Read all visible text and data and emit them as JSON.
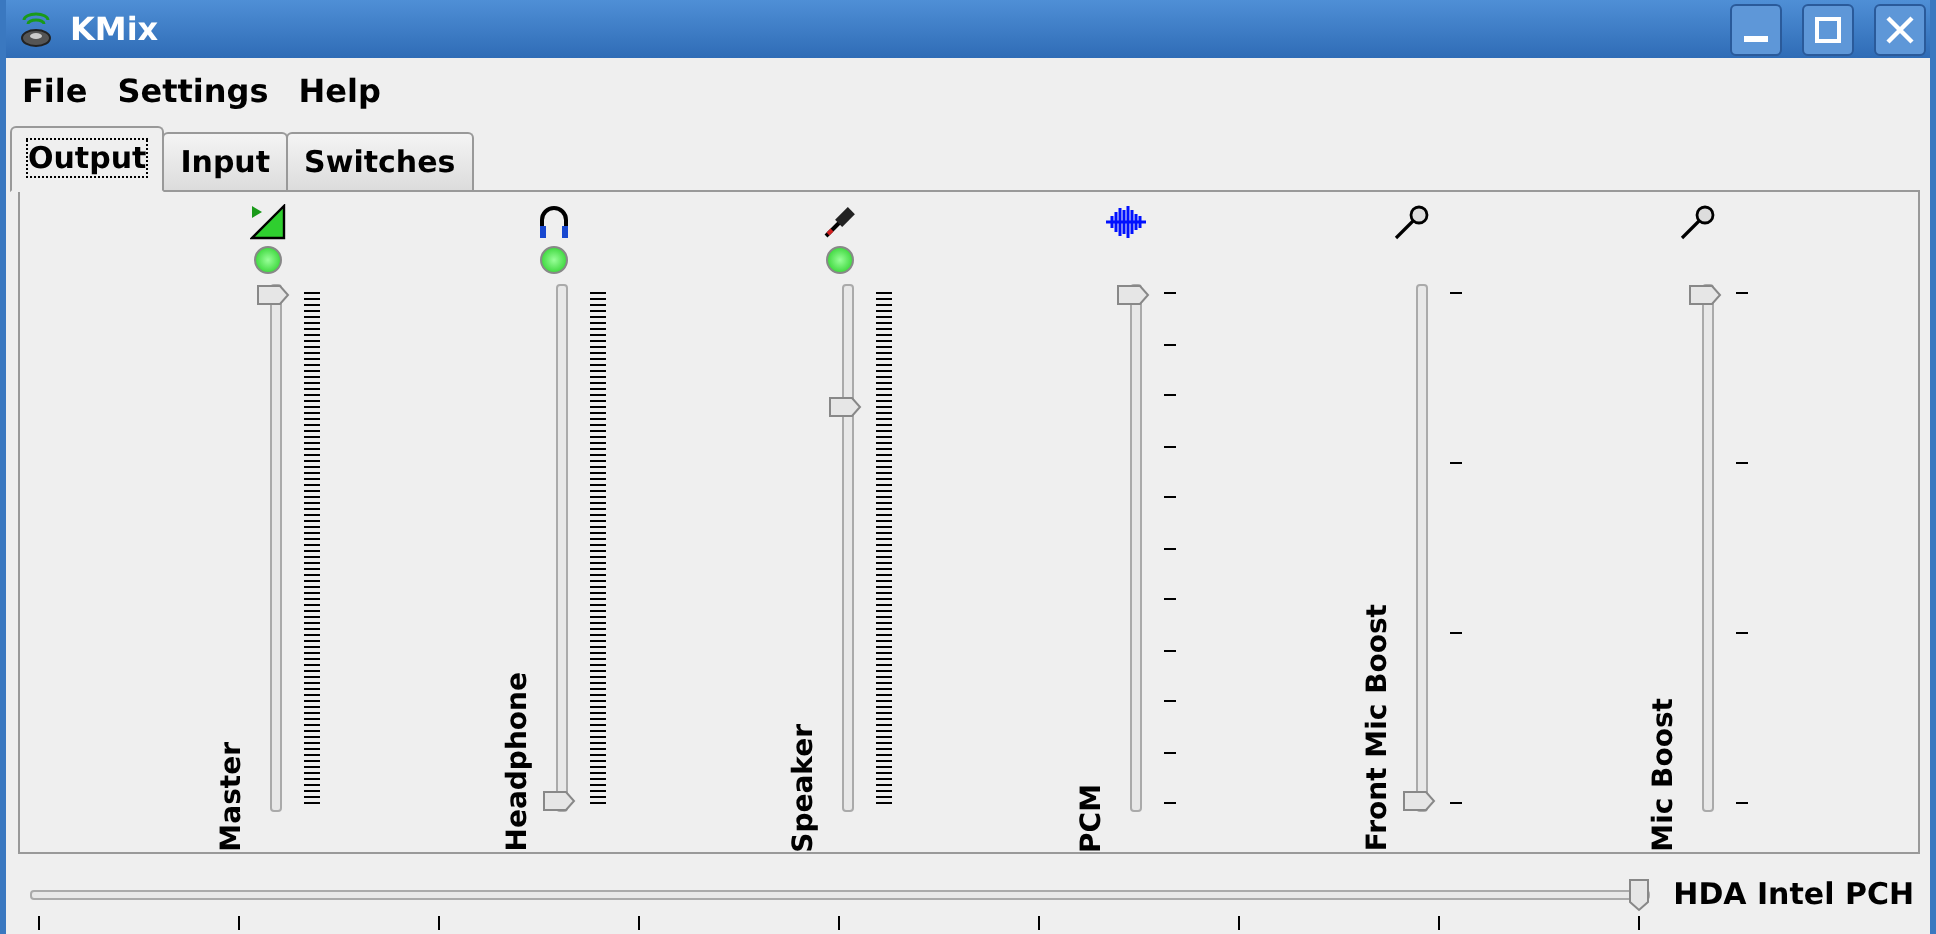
{
  "window": {
    "title": "KMix"
  },
  "menu": [
    "File",
    "Settings",
    "Help"
  ],
  "tabs": [
    {
      "label": "Output",
      "selected": true
    },
    {
      "label": "Input",
      "selected": false
    },
    {
      "label": "Switches",
      "selected": false
    }
  ],
  "channels": [
    {
      "name": "Master",
      "kind": "meter",
      "switch": {
        "on": true
      },
      "level": 1
    },
    {
      "name": "Headphone",
      "kind": "meter",
      "switch": {
        "on": true
      },
      "level": 0
    },
    {
      "name": "Speaker",
      "kind": "meter",
      "switch": {
        "on": true
      },
      "level": 0.78
    },
    {
      "name": "PCM",
      "kind": "fine",
      "level": 1
    },
    {
      "name": "Front Mic Boost",
      "kind": "coarse",
      "level": 0
    },
    {
      "name": "Mic Boost",
      "kind": "coarse",
      "level": 1
    }
  ],
  "card": {
    "name": "HDA Intel PCH",
    "level": 1
  }
}
